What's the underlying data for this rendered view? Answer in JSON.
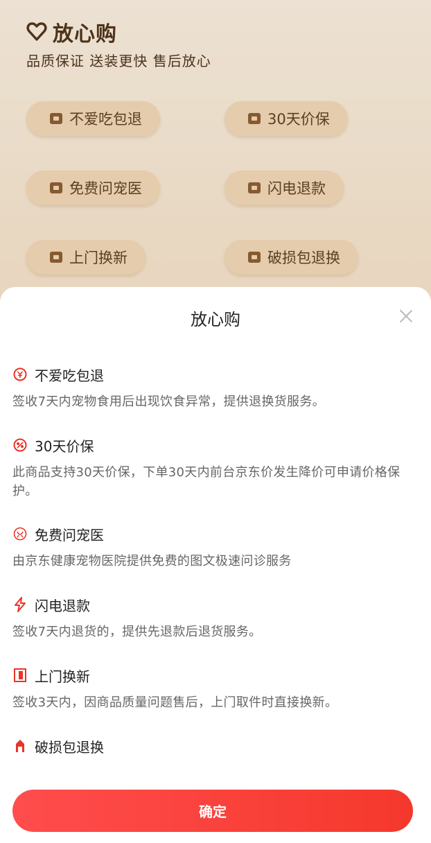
{
  "background": {
    "title": "放心购",
    "subtitle": "品质保证 送装更快 售后放心",
    "chips": [
      "不爱吃包退",
      "30天价保",
      "免费问宠医",
      "闪电退款",
      "上门换新",
      "破损包退换"
    ]
  },
  "sheet": {
    "title": "放心购",
    "items": [
      {
        "title": "不爱吃包退",
        "desc": "签收7天内宠物食用后出现饮食异常，提供退换货服务。",
        "icon": "refund-coin-icon"
      },
      {
        "title": "30天价保",
        "desc": "此商品支持30天价保，下单30天内前台京东价发生降价可申请价格保护。",
        "icon": "price-protect-icon"
      },
      {
        "title": "免费问宠医",
        "desc": "由京东健康宠物医院提供免费的图文极速问诊服务",
        "icon": "pet-doctor-icon"
      },
      {
        "title": "闪电退款",
        "desc": "签收7天内退货的，提供先退款后退货服务。",
        "icon": "lightning-icon"
      },
      {
        "title": "上门换新",
        "desc": "签收3天内，因商品质量问题售后，上门取件时直接换新。",
        "icon": "door-icon"
      },
      {
        "title": "破损包退换",
        "desc": "",
        "icon": "package-icon"
      }
    ],
    "confirm_label": "确定"
  },
  "colors": {
    "accent": "#f5382c",
    "bg_brown": "#4a2e15"
  }
}
